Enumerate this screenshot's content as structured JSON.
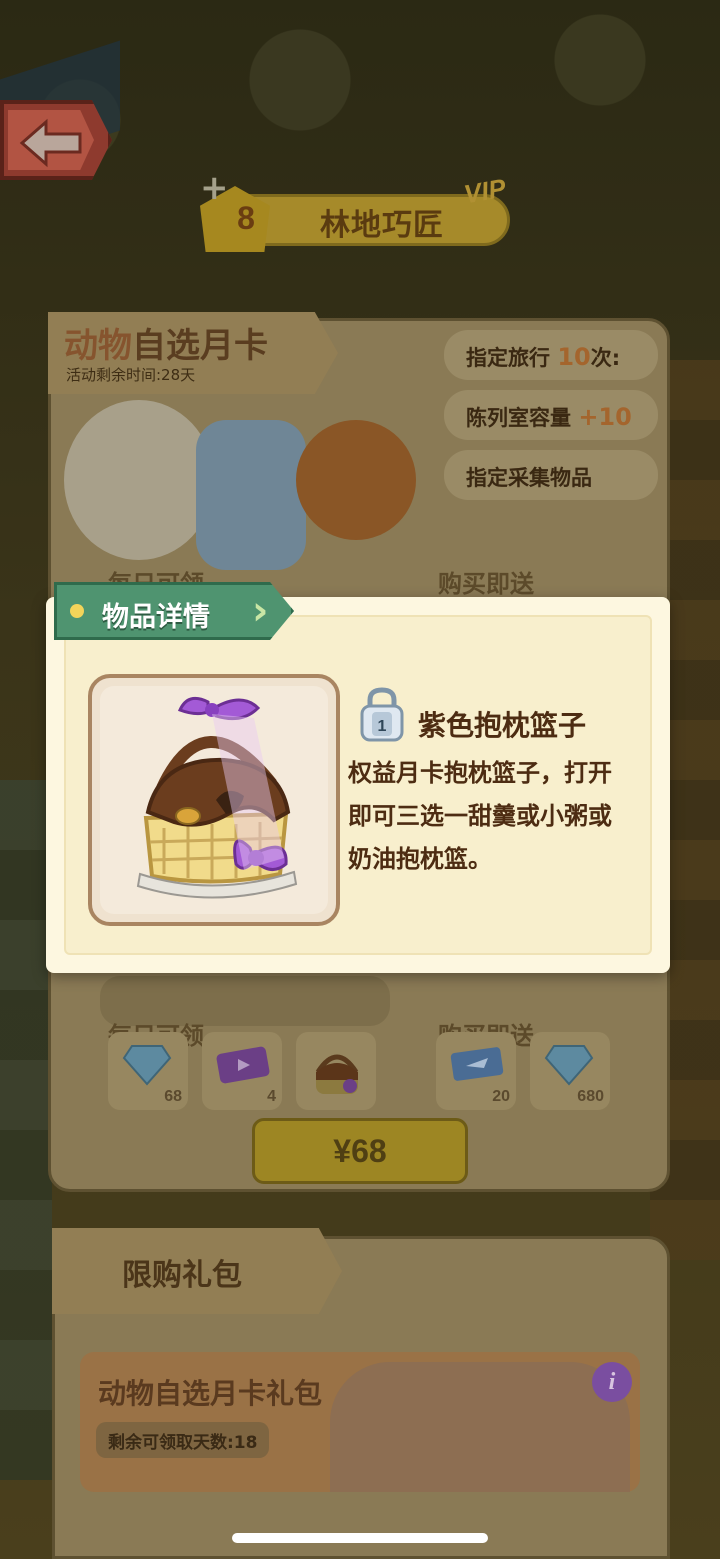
{
  "header": {
    "level": "8",
    "title": "林地巧匠",
    "vip": "VIP",
    "plus_symbol": "+"
  },
  "month_card": {
    "title_part1": "动物",
    "title_part2": "自选月卡",
    "remaining_time": "活动剩余时间:28天",
    "perks": {
      "travel_prefix": "指定旅行",
      "travel_count": "10",
      "travel_suffix": "次:",
      "display_label": "陈列室容量",
      "display_bonus": "+10",
      "collect_label": "指定采集物品"
    },
    "daily_label": "每日可领",
    "purchase_label": "购买即送",
    "daily_rewards": [
      {
        "icon": "diamond-icon",
        "count": "68"
      },
      {
        "icon": "video-ticket-icon",
        "count": "4"
      },
      {
        "icon": "pillow-basket-icon",
        "count": ""
      }
    ],
    "purchase_rewards": [
      {
        "icon": "travel-ticket-icon",
        "count": "20"
      },
      {
        "icon": "diamond-icon",
        "count": "680"
      }
    ],
    "price": "¥68"
  },
  "limited_gift": {
    "tab_label": "限购礼包",
    "card_title": "动物自选月卡礼包",
    "days_left": "剩余可领取天数:18",
    "info_symbol": "i"
  },
  "popup": {
    "header_title": "物品详情",
    "lock_level": "1",
    "item_name": "紫色抱枕篮子",
    "item_description": "权益月卡抱枕篮子，打开即可三选一甜羹或小粥或奶油抱枕篮。",
    "colors": {
      "header_green": "#4f9470",
      "ribbon_purple": "#a35ad6",
      "basket_brown": "#6b3d1e"
    }
  }
}
